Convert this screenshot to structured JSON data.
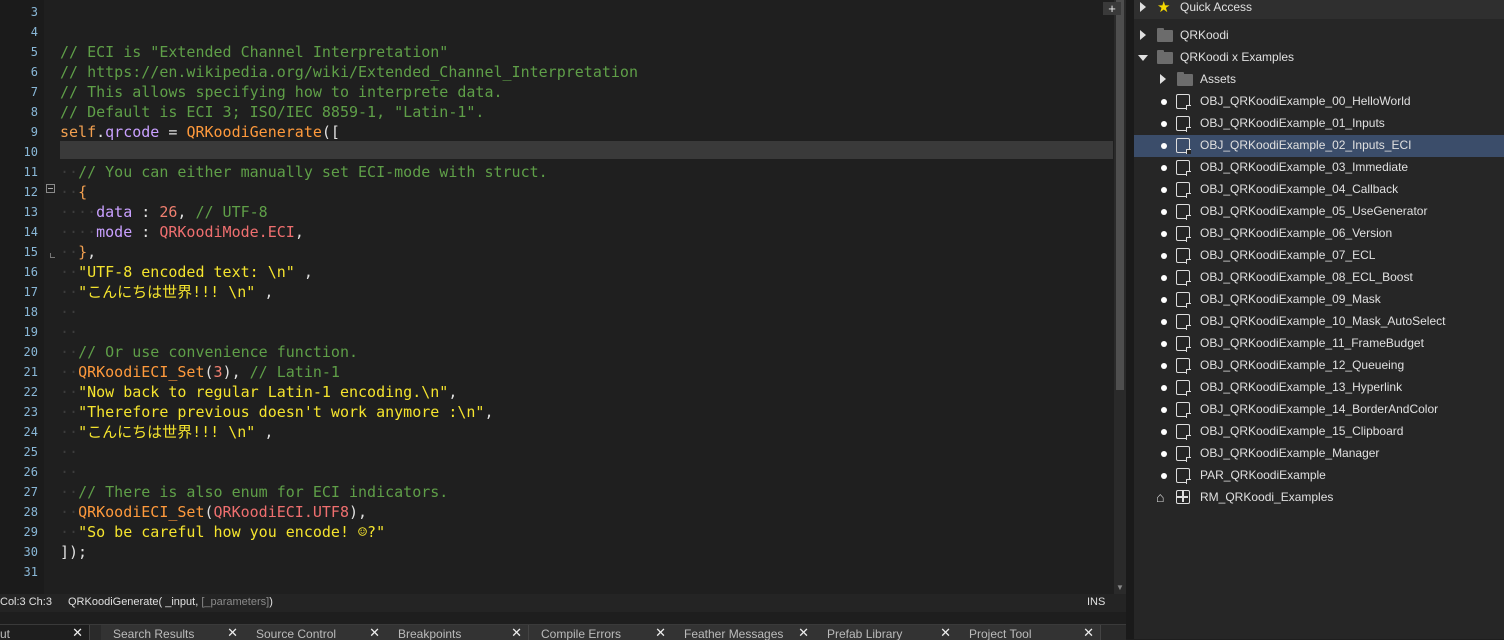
{
  "editor": {
    "line_numbers": [
      "3",
      "4",
      "5",
      "6",
      "7",
      "8",
      "9",
      "10",
      "11",
      "12",
      "13",
      "14",
      "15",
      "16",
      "17",
      "18",
      "19",
      "20",
      "21",
      "22",
      "23",
      "24",
      "25",
      "26",
      "27",
      "28",
      "29",
      "30",
      "31"
    ],
    "lines": [
      [],
      [],
      [
        {
          "c": "cmt",
          "t": "// ECI is \"Extended Channel Interpretation\""
        }
      ],
      [
        {
          "c": "cmt",
          "t": "// https://en.wikipedia.org/wiki/Extended_Channel_Interpretation"
        }
      ],
      [
        {
          "c": "cmt",
          "t": "// This allows specifying how to interprete data."
        }
      ],
      [
        {
          "c": "cmt",
          "t": "// Default is ECI 3; ISO/IEC 8859-1, \"Latin-1\"."
        }
      ],
      [
        {
          "c": "kw",
          "t": "self"
        },
        {
          "c": "pun",
          "t": "."
        },
        {
          "c": "var",
          "t": "qrcode"
        },
        {
          "c": "pun",
          "t": " = "
        },
        {
          "c": "fn",
          "t": "QRKoodiGenerate"
        },
        {
          "c": "pun",
          "t": "(["
        }
      ],
      [],
      [
        {
          "c": "ind",
          "t": "··"
        },
        {
          "c": "cmt",
          "t": "// You can either manually set ECI-mode with struct."
        }
      ],
      [
        {
          "c": "ind",
          "t": "··"
        },
        {
          "c": "kw",
          "t": "{"
        }
      ],
      [
        {
          "c": "ind",
          "t": "····"
        },
        {
          "c": "var",
          "t": "data"
        },
        {
          "c": "pun",
          "t": " : "
        },
        {
          "c": "num",
          "t": "26"
        },
        {
          "c": "pun",
          "t": ", "
        },
        {
          "c": "cmt",
          "t": "// UTF-8"
        }
      ],
      [
        {
          "c": "ind",
          "t": "····"
        },
        {
          "c": "var",
          "t": "mode"
        },
        {
          "c": "pun",
          "t": " : "
        },
        {
          "c": "cst",
          "t": "QRKoodiMode.ECI"
        },
        {
          "c": "pun",
          "t": ","
        }
      ],
      [
        {
          "c": "ind",
          "t": "··"
        },
        {
          "c": "kw",
          "t": "}"
        },
        {
          "c": "pun",
          "t": ","
        }
      ],
      [
        {
          "c": "ind",
          "t": "··"
        },
        {
          "c": "str",
          "t": "\"UTF-8 encoded text: \\n\""
        },
        {
          "c": "pun",
          "t": " ,"
        }
      ],
      [
        {
          "c": "ind",
          "t": "··"
        },
        {
          "c": "str",
          "t": "\"こんにちは世界!!! \\n\""
        },
        {
          "c": "pun",
          "t": " ,"
        }
      ],
      [
        {
          "c": "ind",
          "t": "··"
        }
      ],
      [
        {
          "c": "ind",
          "t": "··"
        }
      ],
      [
        {
          "c": "ind",
          "t": "··"
        },
        {
          "c": "cmt",
          "t": "// Or use convenience function."
        }
      ],
      [
        {
          "c": "ind",
          "t": "··"
        },
        {
          "c": "fn",
          "t": "QRKoodiECI_Set"
        },
        {
          "c": "pun",
          "t": "("
        },
        {
          "c": "num",
          "t": "3"
        },
        {
          "c": "pun",
          "t": "), "
        },
        {
          "c": "cmt",
          "t": "// Latin-1"
        }
      ],
      [
        {
          "c": "ind",
          "t": "··"
        },
        {
          "c": "str",
          "t": "\"Now back to regular Latin-1 encoding.\\n\""
        },
        {
          "c": "pun",
          "t": ","
        }
      ],
      [
        {
          "c": "ind",
          "t": "··"
        },
        {
          "c": "str",
          "t": "\"Therefore previous doesn't work anymore :\\n\""
        },
        {
          "c": "pun",
          "t": ","
        }
      ],
      [
        {
          "c": "ind",
          "t": "··"
        },
        {
          "c": "str",
          "t": "\"こんにちは世界!!! \\n\""
        },
        {
          "c": "pun",
          "t": " ,"
        }
      ],
      [
        {
          "c": "ind",
          "t": "··"
        }
      ],
      [
        {
          "c": "ind",
          "t": "··"
        }
      ],
      [
        {
          "c": "ind",
          "t": "··"
        },
        {
          "c": "cmt",
          "t": "// There is also enum for ECI indicators."
        }
      ],
      [
        {
          "c": "ind",
          "t": "··"
        },
        {
          "c": "fn",
          "t": "QRKoodiECI_Set"
        },
        {
          "c": "pun",
          "t": "("
        },
        {
          "c": "cst",
          "t": "QRKoodiECI.UTF8"
        },
        {
          "c": "pun",
          "t": "),"
        }
      ],
      [
        {
          "c": "ind",
          "t": "··"
        },
        {
          "c": "str",
          "t": "\"So be careful how you encode! ☺?\""
        }
      ],
      [
        {
          "c": "pun",
          "t": "]);"
        }
      ],
      []
    ]
  },
  "status": {
    "position": "Col:3 Ch:3",
    "signature": "QRKoodiGenerate( _input, ",
    "signature_optional": "[_parameters]",
    "signature_close": ")",
    "mode": "INS"
  },
  "bottom_tabs": [
    {
      "label": "ut",
      "close": "✕"
    },
    {
      "label": "Search Results",
      "close": "✕"
    },
    {
      "label": "Source Control",
      "close": "✕"
    },
    {
      "label": "Breakpoints",
      "close": "✕"
    },
    {
      "label": "Compile Errors",
      "close": "✕"
    },
    {
      "label": "Feather Messages",
      "close": "✕"
    },
    {
      "label": "Prefab Library",
      "close": "✕"
    },
    {
      "label": "Project Tool",
      "close": "✕"
    }
  ],
  "bottom_tabs_add": "+",
  "tree": {
    "quick_access": "Quick Access",
    "qrkoodi": "QRKoodi",
    "examples": "QRKoodi x Examples",
    "assets": "Assets",
    "items": [
      "OBJ_QRKoodiExample_00_HelloWorld",
      "OBJ_QRKoodiExample_01_Inputs",
      "OBJ_QRKoodiExample_02_Inputs_ECI",
      "OBJ_QRKoodiExample_03_Immediate",
      "OBJ_QRKoodiExample_04_Callback",
      "OBJ_QRKoodiExample_05_UseGenerator",
      "OBJ_QRKoodiExample_06_Version",
      "OBJ_QRKoodiExample_07_ECL",
      "OBJ_QRKoodiExample_08_ECL_Boost",
      "OBJ_QRKoodiExample_09_Mask",
      "OBJ_QRKoodiExample_10_Mask_AutoSelect",
      "OBJ_QRKoodiExample_11_FrameBudget",
      "OBJ_QRKoodiExample_12_Queueing",
      "OBJ_QRKoodiExample_13_Hyperlink",
      "OBJ_QRKoodiExample_14_BorderAndColor",
      "OBJ_QRKoodiExample_15_Clipboard",
      "OBJ_QRKoodiExample_Manager",
      "PAR_QRKoodiExample"
    ],
    "selected_item": "OBJ_QRKoodiExample_02_Inputs_ECI",
    "room": "RM_QRKoodi_Examples"
  }
}
